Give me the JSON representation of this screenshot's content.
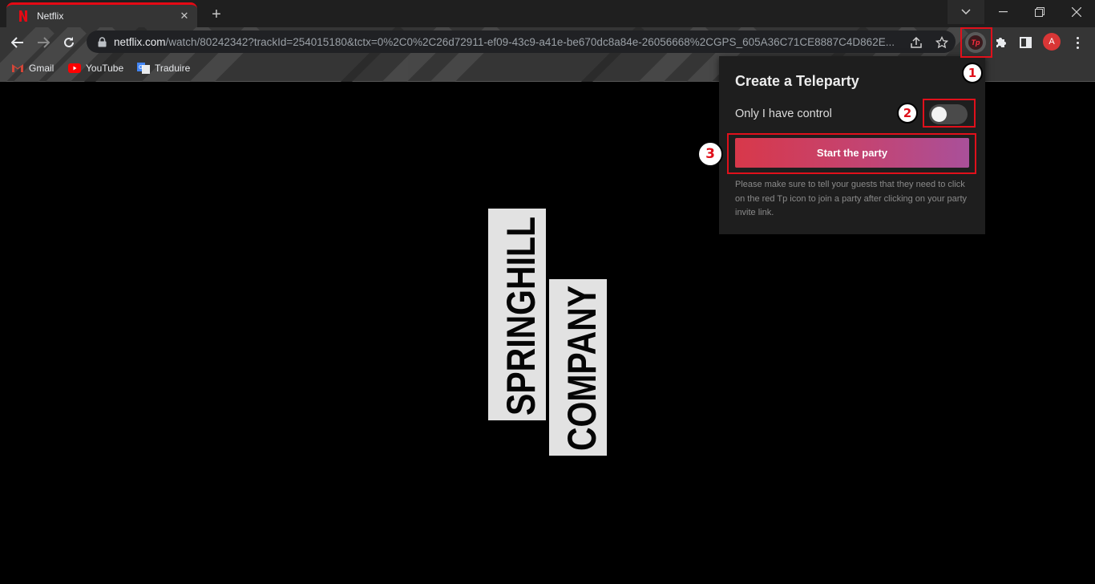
{
  "tab": {
    "title": "Netflix"
  },
  "address_bar": {
    "url_host": "netflix.com",
    "url_path": "/watch/80242342?trackId=254015180&tctx=0%2C0%2C26d72911-ef09-43c9-a41e-be670dc8a84e-26056668%2CGPS_605A36C71CE8887C4D862E..."
  },
  "bookmarks": [
    {
      "label": "Gmail",
      "icon": "gmail-icon"
    },
    {
      "label": "YouTube",
      "icon": "youtube-icon"
    },
    {
      "label": "Traduire",
      "icon": "translate-icon"
    }
  ],
  "extension": {
    "label": "Tp"
  },
  "profile": {
    "initial": "A"
  },
  "popup": {
    "title": "Create a Teleparty",
    "control_label": "Only I have control",
    "toggle_on": false,
    "start_button": "Start the party",
    "note": "Please make sure to tell your guests that they need to click on the red Tp icon to join a party after clicking on your party invite link."
  },
  "steps": [
    "1",
    "2",
    "3"
  ],
  "logo": {
    "line1": "SPRINGHILL",
    "line2": "COMPANY"
  },
  "colors": {
    "highlight": "#e0101b",
    "netflix_red": "#e50914",
    "button_start": "#d8384a",
    "button_end": "#a9509a"
  }
}
